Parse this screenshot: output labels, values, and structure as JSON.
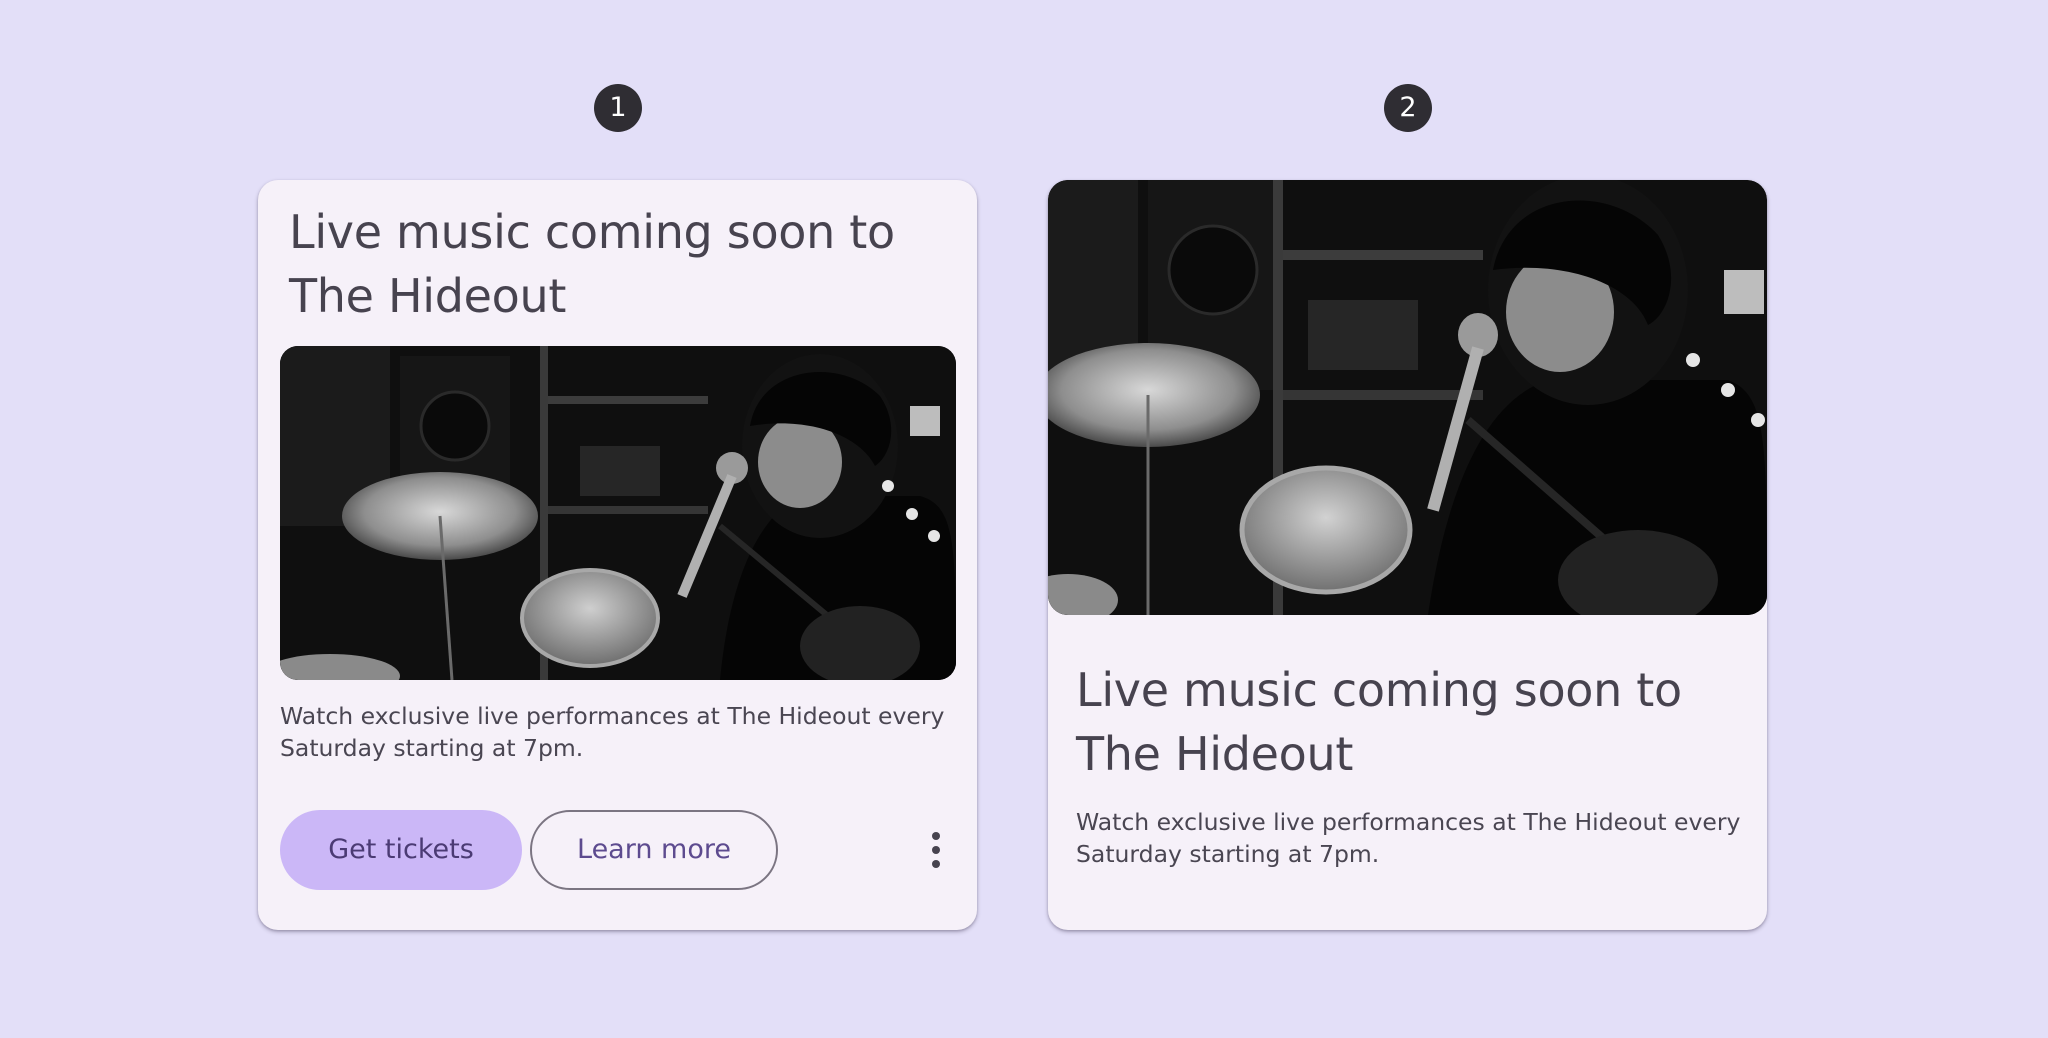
{
  "labels": {
    "first": "1",
    "second": "2"
  },
  "card_1": {
    "title": "Live music coming soon to The Hideout",
    "image": "black-and-white photo of a singer performing at a microphone beside a drum kit",
    "description": "Watch exclusive live performances at The Hideout every Saturday starting at 7pm.",
    "primary_button": "Get tickets",
    "secondary_button": "Learn more",
    "overflow_icon": "more-vert-icon"
  },
  "card_2": {
    "image": "black-and-white photo of a singer performing at a microphone beside a drum kit",
    "title": "Live music coming soon to The Hideout",
    "description": "Watch exclusive live performances at The Hideout every Saturday starting at 7pm."
  },
  "colors": {
    "background": "#e3dff8",
    "card": "#f6f1f9",
    "primary_button": "#cbb7f7",
    "badge": "#2f2d33"
  }
}
